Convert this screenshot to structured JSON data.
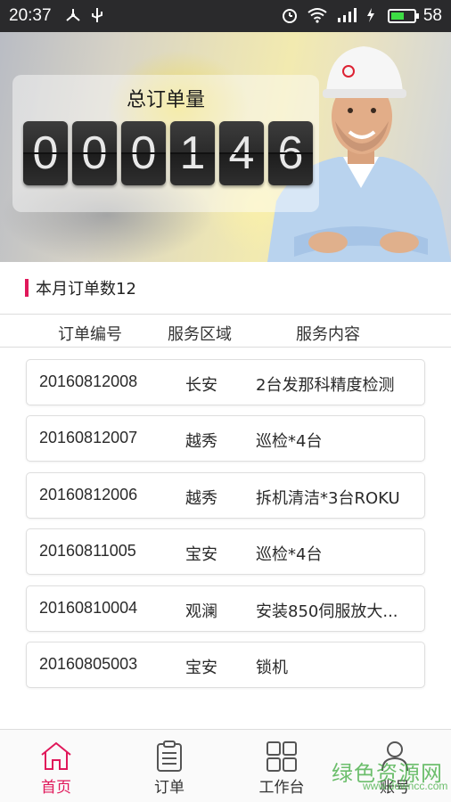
{
  "status_bar": {
    "time": "20:37",
    "battery_level": "58",
    "battery_fraction": 0.58,
    "icons": [
      "usb-debug-icon",
      "usb-icon",
      "alarm-icon",
      "wifi-icon",
      "signal-3g-icon",
      "charging-icon",
      "battery-icon"
    ]
  },
  "banner": {
    "title": "总订单量",
    "digits": [
      "0",
      "0",
      "0",
      "1",
      "4",
      "6"
    ]
  },
  "month": {
    "label": "本月订单数12"
  },
  "table": {
    "headers": [
      "订单编号",
      "服务区域",
      "服务内容"
    ],
    "rows": [
      {
        "id": "20160812008",
        "area": "长安",
        "content": "2台发那科精度检测"
      },
      {
        "id": "20160812007",
        "area": "越秀",
        "content": "巡检*4台"
      },
      {
        "id": "20160812006",
        "area": "越秀",
        "content": "拆机清洁*3台ROKU"
      },
      {
        "id": "20160811005",
        "area": "宝安",
        "content": "巡检*4台"
      },
      {
        "id": "20160810004",
        "area": "观澜",
        "content": "安装850伺服放大..."
      },
      {
        "id": "20160805003",
        "area": "宝安",
        "content": "锁机"
      }
    ]
  },
  "nav": {
    "items": [
      {
        "label": "首页",
        "icon": "home-icon",
        "active": true
      },
      {
        "label": "订单",
        "icon": "clipboard-icon",
        "active": false
      },
      {
        "label": "工作台",
        "icon": "grid-icon",
        "active": false
      },
      {
        "label": "账号",
        "icon": "user-icon",
        "active": false
      }
    ]
  },
  "watermark": {
    "text": "绿色资源网",
    "url": "www.downcc.com"
  },
  "colors": {
    "accent": "#e0185a",
    "status_bar": "#2a2a2c",
    "battery": "#3ddc44"
  }
}
